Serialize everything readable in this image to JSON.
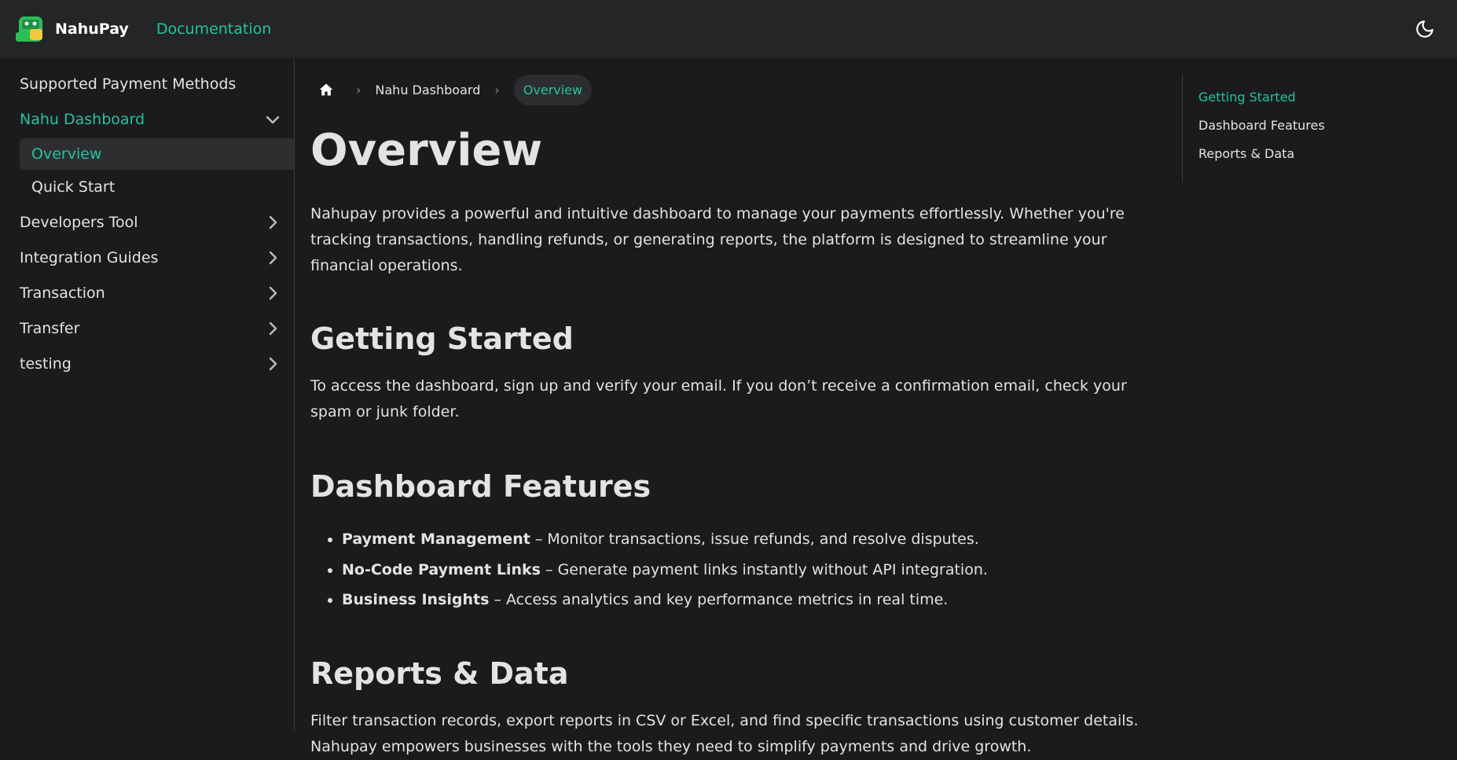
{
  "navbar": {
    "brand": "NahuPay",
    "doc_link": "Documentation"
  },
  "sidebar": {
    "items": [
      {
        "label": "Supported Payment Methods"
      },
      {
        "label": "Nahu Dashboard"
      },
      {
        "label": "Developers Tool"
      },
      {
        "label": "Integration Guides"
      },
      {
        "label": "Transaction"
      },
      {
        "label": "Transfer"
      },
      {
        "label": "testing"
      }
    ],
    "subitems": [
      {
        "label": "Overview"
      },
      {
        "label": "Quick Start"
      }
    ]
  },
  "breadcrumbs": {
    "parent": "Nahu Dashboard",
    "current": "Overview"
  },
  "content": {
    "title": "Overview",
    "intro": "Nahupay provides a powerful and intuitive dashboard to manage your payments effortlessly. Whether you're tracking transactions, handling refunds, or generating reports, the platform is designed to streamline your financial operations.",
    "getting_started": {
      "heading": "Getting Started",
      "text": "To access the dashboard, sign up and verify your email. If you don’t receive a confirmation email, check your spam or junk folder."
    },
    "features": {
      "heading": "Dashboard Features",
      "items": [
        {
          "name": "Payment Management",
          "desc": " – Monitor transactions, issue refunds, and resolve disputes."
        },
        {
          "name": "No-Code Payment Links",
          "desc": " – Generate payment links instantly without API integration."
        },
        {
          "name": "Business Insights",
          "desc": " – Access analytics and key performance metrics in real time."
        }
      ]
    },
    "reports": {
      "heading": "Reports & Data",
      "text": "Filter transaction records, export reports in CSV or Excel, and find specific transactions using customer details. Nahupay empowers businesses with the tools they need to simplify payments and drive growth."
    }
  },
  "toc": {
    "items": [
      {
        "label": "Getting Started"
      },
      {
        "label": "Dashboard Features"
      },
      {
        "label": "Reports & Data"
      }
    ]
  },
  "colors": {
    "accent": "#25c2a0",
    "background": "#1b1b1d",
    "navbar": "#242526",
    "text": "#e3e3e3"
  },
  "icons": {
    "logo": "nahupay-logo-icon",
    "theme": "moon-icon",
    "home": "home-icon",
    "caret_down": "chevron-down-icon",
    "caret_right": "chevron-right-icon"
  }
}
